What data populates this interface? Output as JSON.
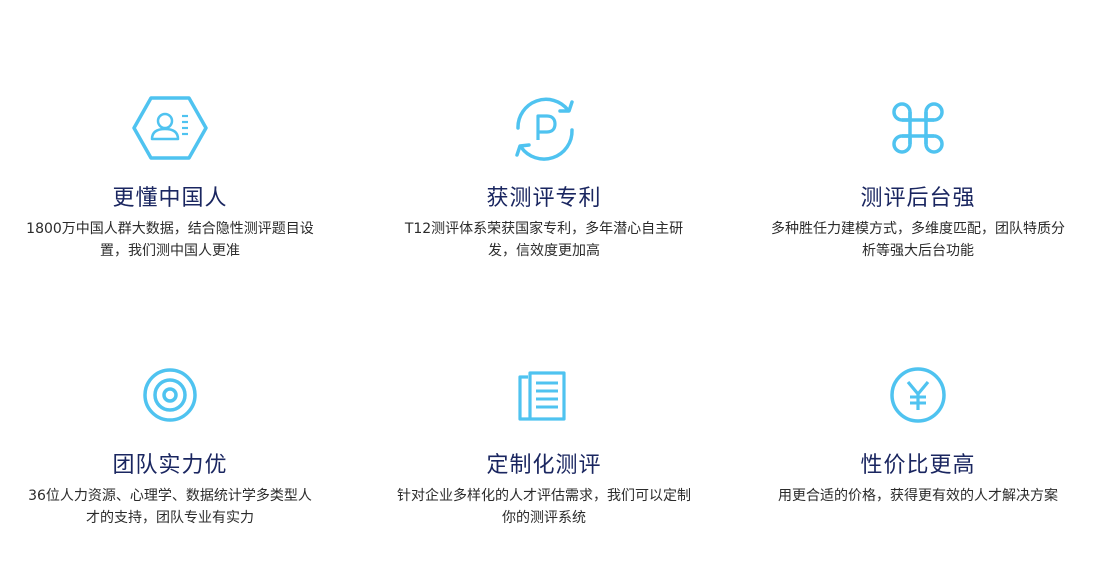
{
  "features": [
    {
      "icon": "user-profile-hexagon-icon",
      "title": "更懂中国人",
      "description": "1800万中国人群大数据，结合隐性测评题目设置，我们测中国人更准"
    },
    {
      "icon": "patent-refresh-icon",
      "title": "获测评专利",
      "description": "T12测评体系荣获国家专利，多年潜心自主研发，信效度更加高"
    },
    {
      "icon": "command-key-icon",
      "title": "测评后台强",
      "description": "多种胜任力建模方式，多维度匹配，团队特质分析等强大后台功能"
    },
    {
      "icon": "target-icon",
      "title": "团队实力优",
      "description": "36位人力资源、心理学、数据统计学多类型人才的支持，团队专业有实力"
    },
    {
      "icon": "document-list-icon",
      "title": "定制化测评",
      "description": "针对企业多样化的人才评估需求，我们可以定制你的测评系统"
    },
    {
      "icon": "yuan-coin-icon",
      "title": "性价比更高",
      "description": "用更合适的价格，获得更有效的人才解决方案"
    }
  ],
  "colors": {
    "icon": "#4fc3f0",
    "title": "#1a2660",
    "text": "#2b2b2b"
  }
}
